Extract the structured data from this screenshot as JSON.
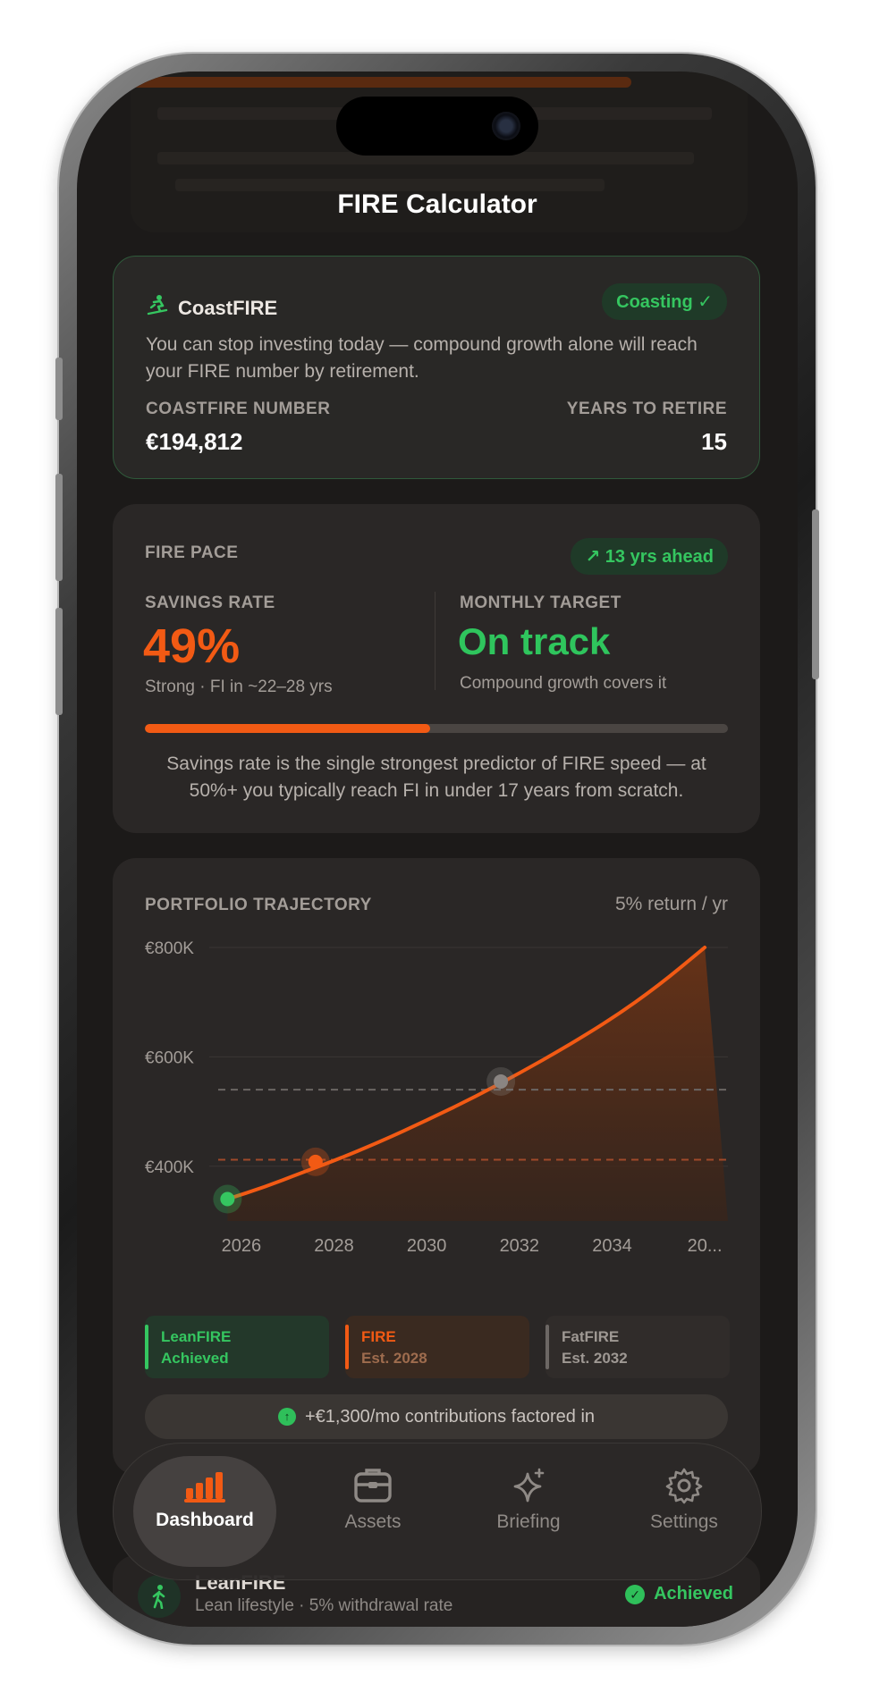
{
  "app": {
    "title": "FIRE Calculator"
  },
  "coast": {
    "name": "CoastFIRE",
    "badge": "Coasting ✓",
    "description": "You can stop investing today — compound growth alone will reach your FIRE number by retirement.",
    "number_label": "COASTFIRE NUMBER",
    "number_value": "€194,812",
    "years_label": "YEARS TO RETIRE",
    "years_value": "15"
  },
  "pace": {
    "title": "FIRE PACE",
    "badge": "↗ 13 yrs ahead",
    "savings_label": "SAVINGS RATE",
    "savings_value": "49%",
    "savings_sub": "Strong · FI in ~22–28 yrs",
    "savings_rate_fraction": 0.49,
    "target_label": "MONTHLY TARGET",
    "target_value": "On track",
    "target_sub": "Compound growth covers it",
    "note": "Savings rate is the single strongest predictor of FIRE speed — at 50%+ you typically reach FI in under 17 years from scratch."
  },
  "trajectory": {
    "title": "PORTFOLIO TRAJECTORY",
    "rate": "5% return / yr",
    "contributions": "+€1,300/mo contributions factored in",
    "contrib_icon": "arrow-up-icon"
  },
  "chart_data": {
    "type": "area",
    "title": "PORTFOLIO TRAJECTORY",
    "xlabel": "",
    "ylabel": "",
    "x": [
      2025.7,
      2026.5,
      2027.3,
      2028.0,
      2029.0,
      2030.0,
      2031.0,
      2032.0,
      2033.0,
      2034.0,
      2035.0,
      2036.0
    ],
    "values": [
      340,
      362,
      388,
      410,
      445,
      484,
      525,
      570,
      618,
      670,
      730,
      800
    ],
    "units": "€K",
    "xlim": [
      2025.5,
      2036.5
    ],
    "ylim": [
      300,
      800
    ],
    "y_ticks": [
      "€800K",
      "€600K",
      "€400K"
    ],
    "y_tick_values": [
      800,
      600,
      400
    ],
    "x_ticks": [
      "2026",
      "2028",
      "2030",
      "2032",
      "2034",
      "20..."
    ],
    "x_tick_values": [
      2026,
      2028,
      2030,
      2032,
      2034,
      2036
    ],
    "reference_lines": [
      {
        "value": 412,
        "color": "#a04a2a"
      },
      {
        "value": 540,
        "color": "#6b6663"
      }
    ],
    "markers": [
      {
        "x": 2025.7,
        "y": 340,
        "color": "#35c660"
      },
      {
        "x": 2027.6,
        "y": 408,
        "color": "#f25a14"
      },
      {
        "x": 2031.6,
        "y": 555,
        "color": "#8a8582"
      }
    ],
    "colors": {
      "line": "#f25a14",
      "fill": "#5a2e1a",
      "grid": "#3a3634"
    },
    "grid": true
  },
  "milestones": {
    "lean": {
      "name": "LeanFIRE",
      "status": "Achieved"
    },
    "fire": {
      "name": "FIRE",
      "status": "Est. 2028"
    },
    "fat": {
      "name": "FatFIRE",
      "status": "Est. 2032"
    }
  },
  "nav": {
    "items": [
      {
        "label": "Dashboard",
        "icon": "bar-chart-icon",
        "active": true
      },
      {
        "label": "Assets",
        "icon": "briefcase-icon"
      },
      {
        "label": "Briefing",
        "icon": "sparkles-icon"
      },
      {
        "label": "Settings",
        "icon": "gear-icon"
      }
    ]
  },
  "lean_row": {
    "name": "LeanFIRE",
    "description": "Lean lifestyle · 5% withdrawal rate",
    "status": "Achieved"
  }
}
